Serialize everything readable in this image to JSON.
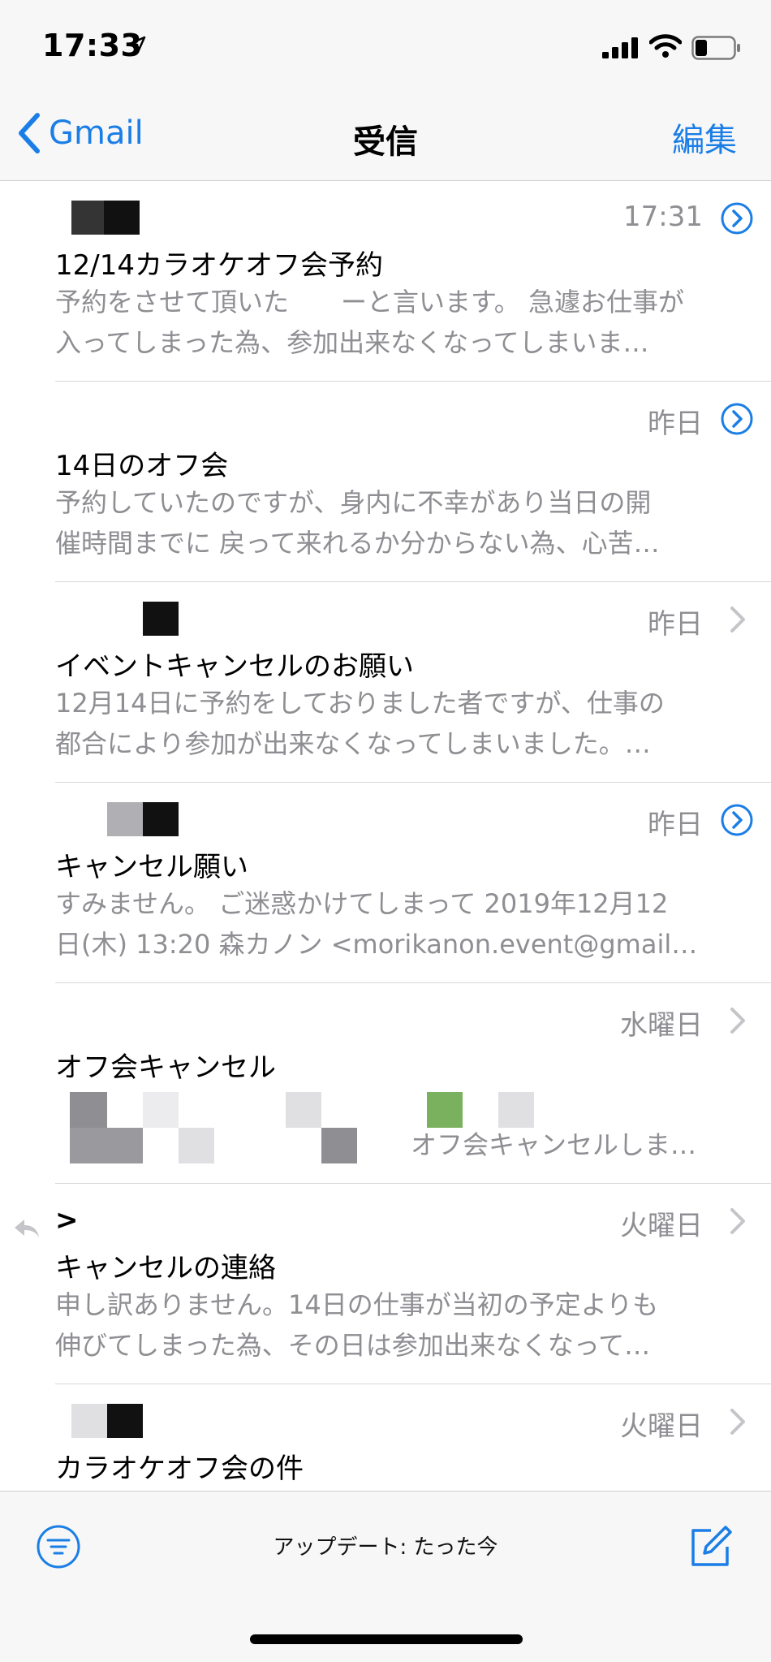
{
  "status_bar": {
    "time": "17:33"
  },
  "nav": {
    "back_label": "Gmail",
    "title": "受信",
    "edit_label": "編集"
  },
  "messages": [
    {
      "sender": "",
      "time": "17:31",
      "subject": "12/14カラオケオフ会予約",
      "preview_1": "予約をさせて頂いた　　ーと言います。 急遽お仕事が",
      "preview_2": "入ってしまった為、参加出来なくなってしまいま…",
      "accessory": "thread-circle"
    },
    {
      "sender": "",
      "time": "昨日",
      "subject": "14日のオフ会",
      "preview_1": "予約していたのですが、身内に不幸があり当日の開",
      "preview_2": "催時間までに 戻って来れるか分からない為、心苦…",
      "accessory": "thread-circle"
    },
    {
      "sender": "",
      "time": "昨日",
      "subject": "イベントキャンセルのお願い",
      "preview_1": "12月14日に予約をしておりました者ですが、仕事の",
      "preview_2": "都合により参加が出来なくなってしまいました。…",
      "accessory": "chevron"
    },
    {
      "sender": "",
      "time": "昨日",
      "subject": "キャンセル願い",
      "preview_1": "すみません。 ご迷惑かけてしまって 2019年12月12",
      "preview_2": "日(木) 13:20 森カノン <morikanon.event@gmail…",
      "accessory": "thread-circle"
    },
    {
      "sender": "",
      "time": "水曜日",
      "subject": "オフ会キャンセル",
      "preview_1": "",
      "preview_2": "オフ会キャンセルしま…",
      "accessory": "chevron"
    },
    {
      "sender": ">",
      "time": "火曜日",
      "subject": "キャンセルの連絡",
      "preview_1": "申し訳ありません。14日の仕事が当初の予定よりも",
      "preview_2": "伸びてしまった為、その日は参加出来なくなって…",
      "accessory": "chevron"
    },
    {
      "sender": "",
      "time": "火曜日",
      "subject": "カラオケオフ会の件",
      "preview_1": "",
      "preview_2": "",
      "accessory": "chevron"
    }
  ],
  "toolbar": {
    "update_status": "アップデート: たった今"
  },
  "colors": {
    "accent": "#1a7ee6",
    "secondary_text": "#8e8e93",
    "bar_bg": "#f7f7f7"
  },
  "icons": [
    "location-arrow-icon",
    "signal-icon",
    "wifi-icon",
    "battery-icon",
    "chevron-left-icon",
    "chevron-circle-icon",
    "chevron-right-icon",
    "reply-icon",
    "filter-icon",
    "compose-icon"
  ]
}
